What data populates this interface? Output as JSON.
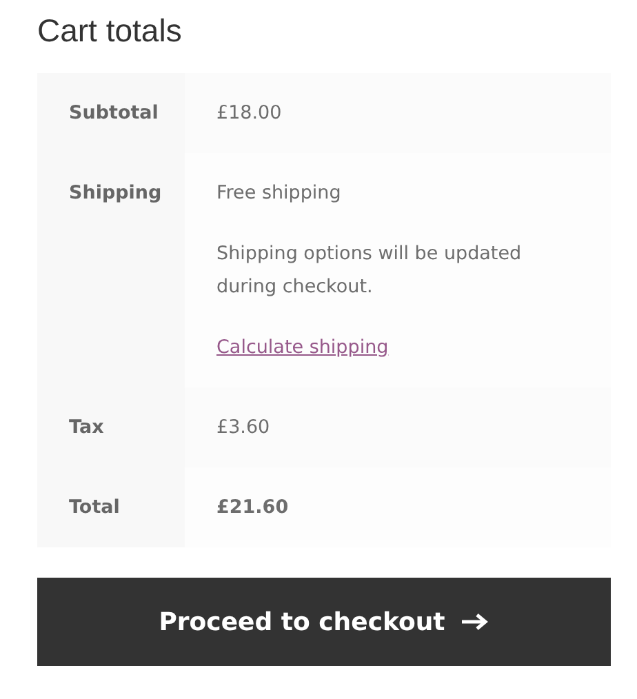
{
  "title": "Cart totals",
  "rows": [
    {
      "label": "Subtotal",
      "strong": false,
      "lines": [
        {
          "kind": "text",
          "text": "£18.00"
        }
      ]
    },
    {
      "label": "Shipping",
      "strong": false,
      "lines": [
        {
          "kind": "text",
          "text": "Free shipping"
        },
        {
          "kind": "text",
          "text": "Shipping options will be updated during checkout."
        },
        {
          "kind": "link",
          "text": "Calculate shipping"
        }
      ]
    },
    {
      "label": "Tax",
      "strong": false,
      "lines": [
        {
          "kind": "text",
          "text": "£3.60"
        }
      ]
    },
    {
      "label": "Total",
      "strong": true,
      "lines": [
        {
          "kind": "text",
          "text": "£21.60"
        }
      ]
    }
  ],
  "button": {
    "label": "Proceed to checkout"
  }
}
